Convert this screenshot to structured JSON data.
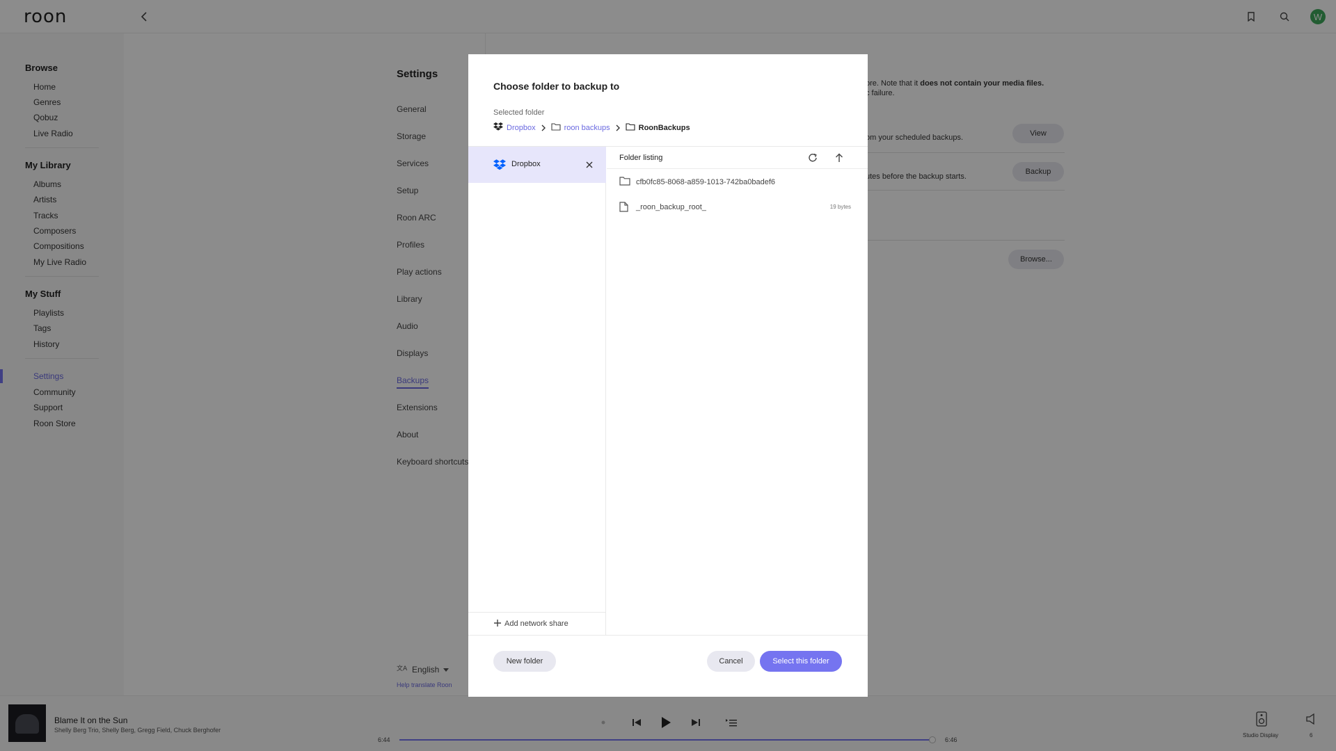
{
  "app": {
    "logo": "roon",
    "avatar_initial": "W"
  },
  "sidebar": {
    "browse": {
      "title": "Browse",
      "items": [
        "Home",
        "Genres",
        "Qobuz",
        "Live Radio"
      ]
    },
    "library": {
      "title": "My Library",
      "items": [
        "Albums",
        "Artists",
        "Tracks",
        "Composers",
        "Compositions",
        "My Live Radio"
      ]
    },
    "stuff": {
      "title": "My Stuff",
      "items": [
        "Playlists",
        "Tags",
        "History"
      ]
    },
    "bottom": {
      "items": [
        "Settings",
        "Community",
        "Support",
        "Roon Store"
      ],
      "active": "Settings"
    }
  },
  "settings": {
    "title": "Settings",
    "items": [
      "General",
      "Storage",
      "Services",
      "Setup",
      "Roon ARC",
      "Profiles",
      "Play actions",
      "Library",
      "Audio",
      "Displays",
      "Backups",
      "Extensions",
      "About",
      "Keyboard shortcuts"
    ],
    "active": "Backups",
    "language": "English",
    "help_translate": "Help translate Roon"
  },
  "backups_page": {
    "line1_a": "ore. Note that it ",
    "line1_b": "does not contain your media files.",
    "line2": "c failure.",
    "row1_text": "om your scheduled backups.",
    "row1_button": "View",
    "row2_text": "utes before the backup starts.",
    "row2_button": "Backup",
    "row3_button": "Browse..."
  },
  "dialog": {
    "title": "Choose folder to backup to",
    "selected_label": "Selected folder",
    "breadcrumb": [
      "Dropbox",
      "roon backups",
      "RoonBackups"
    ],
    "source": "Dropbox",
    "add_share": "Add network share",
    "listing_title": "Folder listing",
    "entries": [
      {
        "name": "cfb0fc85-8068-a859-1013-742ba0badef6",
        "type": "folder",
        "size": ""
      },
      {
        "name": "_roon_backup_root_",
        "type": "file",
        "size": "19 bytes"
      }
    ],
    "new_folder": "New folder",
    "cancel": "Cancel",
    "select": "Select this folder"
  },
  "player": {
    "title": "Blame It on the Sun",
    "artists": "Shelly Berg Trio, Shelly Berg, Gregg Field, Chuck Berghofer",
    "elapsed": "6:44",
    "total": "6:46",
    "progress": 0.995,
    "zone": "Studio Display",
    "volume": "6"
  },
  "colors": {
    "accent": "#7574f0",
    "accent_light": "#e7e6fb",
    "dropbox": "#0061fe"
  }
}
